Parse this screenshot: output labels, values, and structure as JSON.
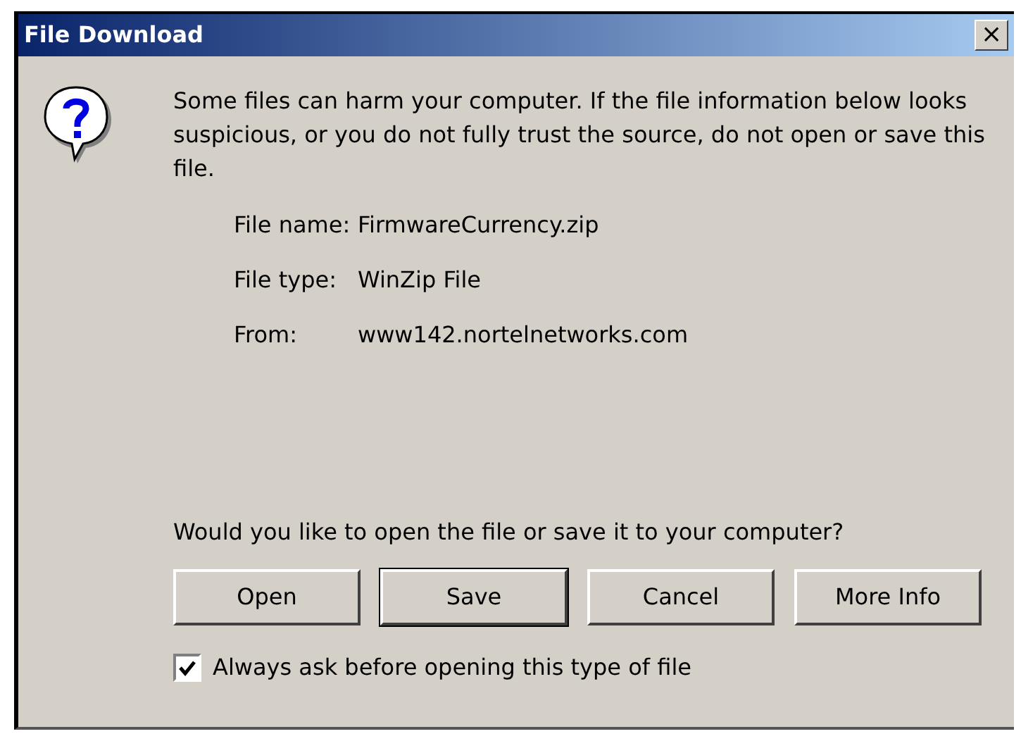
{
  "window": {
    "title": "File Download",
    "close": "×"
  },
  "message": "Some files can harm your computer. If the file information below looks suspicious, or you do not fully trust the source, do not open or save this file.",
  "details": [
    {
      "label": "File name:",
      "value": "FirmwareCurrency.zip"
    },
    {
      "label": "File type:",
      "value": "WinZip File"
    },
    {
      "label": "From:",
      "value": "www142.nortelnetworks.com"
    }
  ],
  "question": "Would you like to open the file or save it to your computer?",
  "buttons": [
    {
      "label": "Open",
      "default": false
    },
    {
      "label": "Save",
      "default": true
    },
    {
      "label": "Cancel",
      "default": false
    },
    {
      "label": "More Info",
      "default": false
    }
  ],
  "always_ask": {
    "label": "Always ask before opening this type of file",
    "checked": true
  }
}
